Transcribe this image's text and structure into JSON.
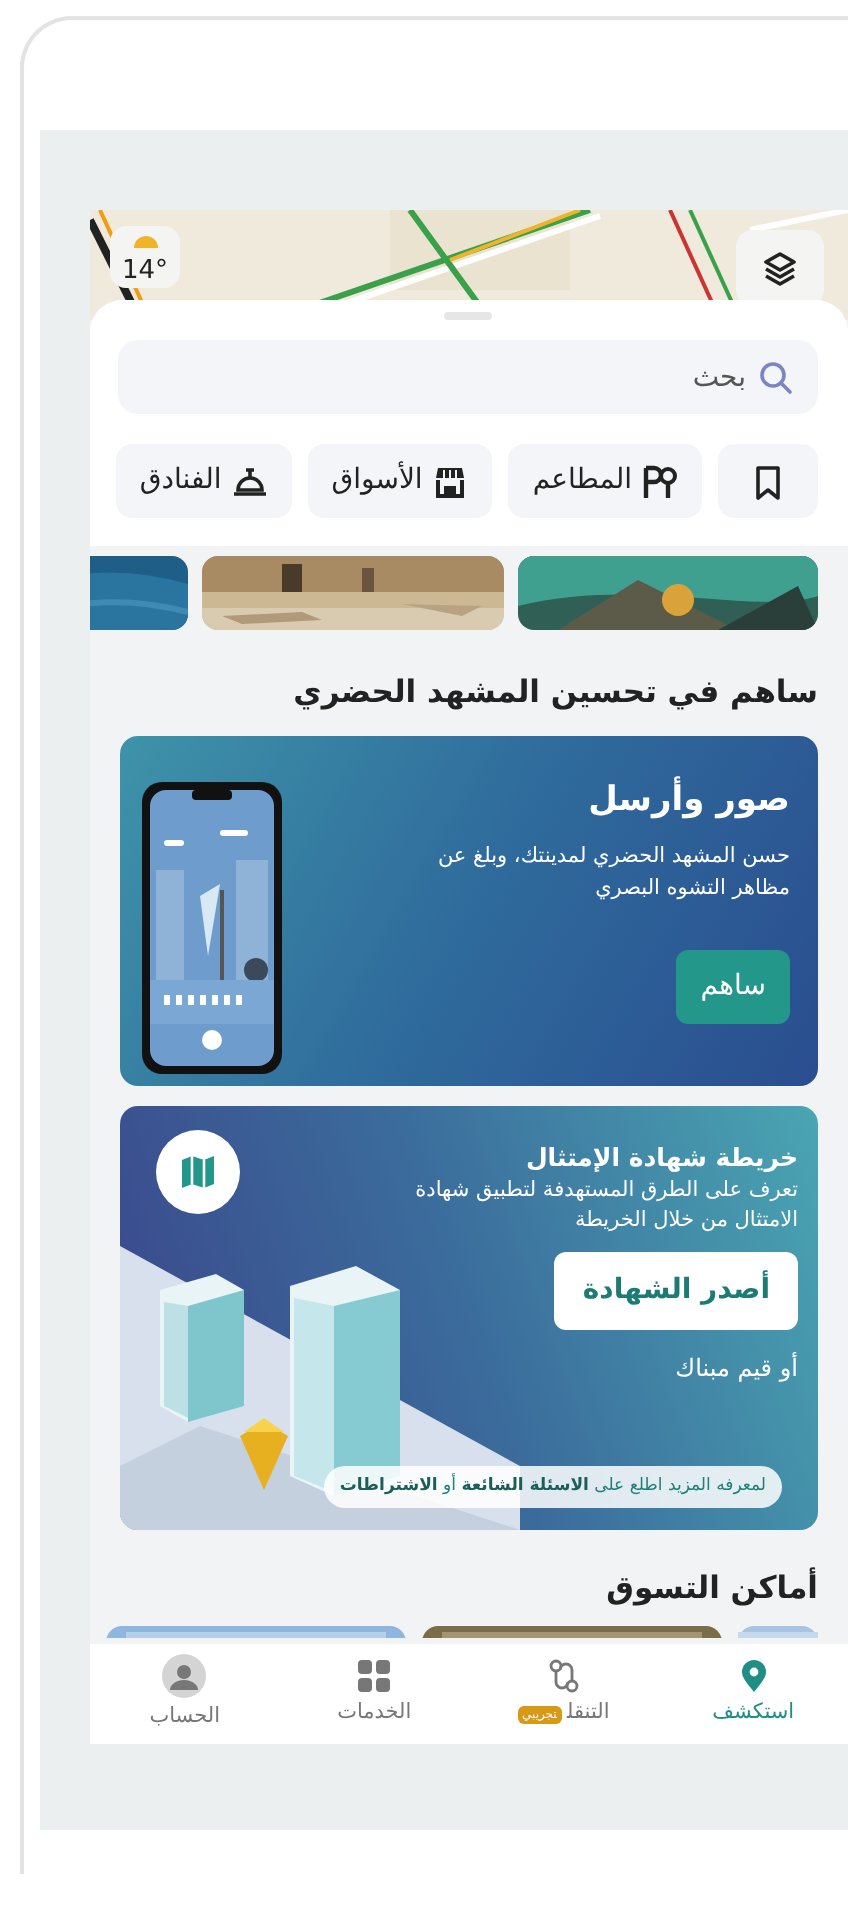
{
  "map": {
    "temperature": "14°"
  },
  "search": {
    "placeholder": "بحث"
  },
  "categories": [
    {
      "kind": "bookmark"
    },
    {
      "kind": "restaurants",
      "label": "المطاعم"
    },
    {
      "kind": "markets",
      "label": "الأسواق"
    },
    {
      "kind": "hotels",
      "label": "الفنادق"
    }
  ],
  "contribute_section": {
    "heading": "ساهم في تحسين المشهد الحضري",
    "card": {
      "title": "صور وأرسل",
      "text": "حسن المشهد الحضري لمدينتك، وبلغ عن مظاهر التشوه البصري",
      "button": "ساهم"
    }
  },
  "certificate_card": {
    "title": "خريطة شهادة الإمتثال",
    "text": "تعرف على الطرق المستهدفة لتطبيق شهادة الامتثال من خلال الخريطة",
    "button": "أصدر الشهادة",
    "subtext": "أو قيم مبناك",
    "note": "لمعرفه المزيد اطلع على **الاسئلة الشائعة** أو **الاشتراطات**"
  },
  "shopping_section": {
    "heading": "أماكن التسوق"
  },
  "bottom_nav": [
    {
      "kind": "explore",
      "label": "استكشف",
      "selected": true
    },
    {
      "kind": "transport",
      "label": "التنقل",
      "badge": "تجريبي",
      "selected": false
    },
    {
      "kind": "services",
      "label": "الخدمات",
      "selected": false
    },
    {
      "kind": "account",
      "label": "الحساب",
      "selected": false
    }
  ]
}
